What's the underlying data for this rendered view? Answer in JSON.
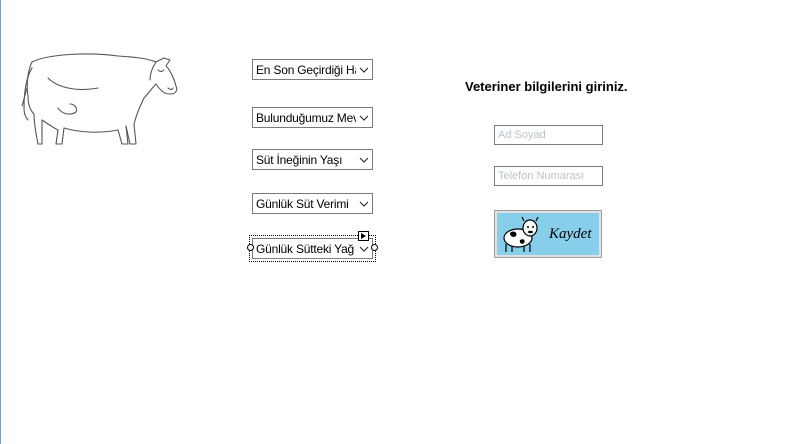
{
  "form": {
    "dropdowns": [
      {
        "value": "En Son Geçirdiği Hastalık"
      },
      {
        "value": "Bulunduğumuz Mevsim"
      },
      {
        "value": "Süt İneğinin Yaşı"
      },
      {
        "value": "Günlük Süt Verimi"
      },
      {
        "value": "Günlük Sütteki Yağ Oranı"
      }
    ]
  },
  "vet": {
    "heading": "Veteriner bilgilerini giriniz.",
    "name_placeholder": "Ad Soyad",
    "phone_placeholder": "Telefon Numarası",
    "save_label": "Kaydet",
    "save_color": "#87ceeb"
  },
  "icons": [
    "cow-drawing-icon",
    "chevron-down-icon",
    "cow-cartoon-icon",
    "smart-tag-icon"
  ]
}
